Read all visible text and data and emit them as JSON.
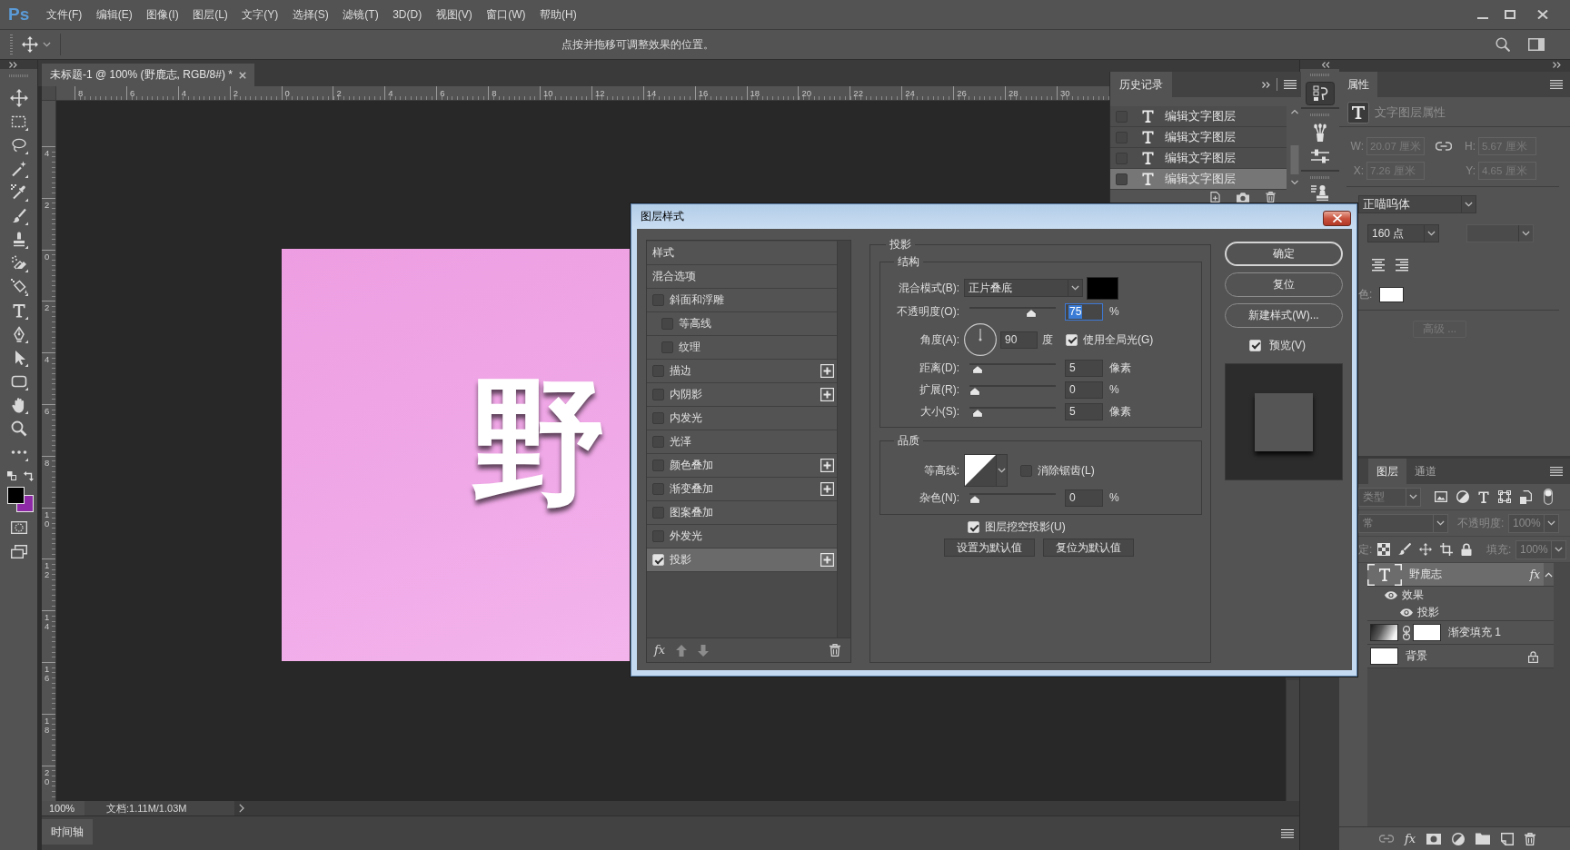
{
  "app": {
    "logo": "Ps"
  },
  "menu_bar": [
    "文件(F)",
    "编辑(E)",
    "图像(I)",
    "图层(L)",
    "文字(Y)",
    "选择(S)",
    "滤镜(T)",
    "3D(D)",
    "视图(V)",
    "窗口(W)",
    "帮助(H)"
  ],
  "options_bar": {
    "hint": "点按并拖移可调整效果的位置。"
  },
  "document": {
    "tab_title": "未标题-1 @ 100% (野鹿志, RGB/8#) *",
    "horizontal_ruler": [
      "8",
      "6",
      "4",
      "2",
      "0",
      "2",
      "4",
      "6",
      "8",
      "10",
      "12",
      "14",
      "16",
      "18",
      "20",
      "22",
      "24",
      "26",
      "28",
      "30"
    ],
    "vertical_ruler": [
      "4",
      "2",
      "0",
      "2",
      "4",
      "6",
      "8",
      "10",
      "12",
      "14",
      "16",
      "18",
      "20"
    ],
    "canvas_text": "野",
    "zoom": "100%",
    "doc_info": "文档:1.11M/1.03M"
  },
  "timeline": {
    "tab": "时间轴"
  },
  "history_panel": {
    "tab": "历史记录",
    "items": [
      {
        "label": "编辑文字图层",
        "checked": false,
        "selected": false
      },
      {
        "label": "编辑文字图层",
        "checked": false,
        "selected": false
      },
      {
        "label": "编辑文字图层",
        "checked": false,
        "selected": false
      },
      {
        "label": "编辑文字图层",
        "checked": false,
        "selected": true
      }
    ]
  },
  "properties_panel": {
    "tab": "属性",
    "heading": "文字图层属性",
    "metrics": [
      {
        "label": "W:",
        "value": "20.07 厘米",
        "disabled": true
      },
      {
        "label": "H:",
        "value": "5.67 厘米",
        "disabled": true
      },
      {
        "label": "X:",
        "value": "7.26 厘米",
        "disabled": true
      },
      {
        "label": "Y:",
        "value": "4.65 厘米",
        "disabled": true
      }
    ],
    "font_family": "正喵呜体",
    "font_size": "160 点",
    "color_label": "色:",
    "advanced_button": {
      "label": "高级 ...",
      "disabled": true
    }
  },
  "layers_panel": {
    "tabs": [
      {
        "label": "图层",
        "selected": true
      },
      {
        "label": "通道",
        "selected": false
      }
    ],
    "filter_kind": "类型",
    "blend_mode": "常",
    "opacity_label": "不透明度:",
    "opacity": "100%",
    "lock_label": "定:",
    "fill_label": "填充:",
    "fill": "100%",
    "layers": [
      {
        "kind": "text",
        "name": "野鹿志",
        "selected": true,
        "expanded": true,
        "badge": "fx",
        "locked": false,
        "children": [
          {
            "kind": "effects",
            "name": "效果",
            "visible": true,
            "children": [
              {
                "kind": "effect",
                "name": "投影",
                "visible": true
              }
            ]
          }
        ]
      },
      {
        "kind": "gradient_fill",
        "name": "渐变填充 1",
        "selected": false,
        "locked": false
      },
      {
        "kind": "background",
        "name": "背景",
        "selected": false,
        "locked": true
      }
    ],
    "footer_fx": "fx"
  },
  "dialog": {
    "title": "图层样式",
    "styles": [
      {
        "kind": "header",
        "label": "样式",
        "selected": false
      },
      {
        "kind": "plain",
        "label": "混合选项",
        "selected": false
      },
      {
        "kind": "check",
        "label": "斜面和浮雕",
        "checked": false,
        "selected": false,
        "add_button": false
      },
      {
        "kind": "subcheck",
        "label": "等高线",
        "checked": false,
        "selected": false,
        "add_button": false
      },
      {
        "kind": "subcheck",
        "label": "纹理",
        "checked": false,
        "selected": false,
        "add_button": false
      },
      {
        "kind": "check",
        "label": "描边",
        "checked": false,
        "selected": false,
        "add_button": true
      },
      {
        "kind": "check",
        "label": "内阴影",
        "checked": false,
        "selected": false,
        "add_button": true
      },
      {
        "kind": "check",
        "label": "内发光",
        "checked": false,
        "selected": false,
        "add_button": false
      },
      {
        "kind": "check",
        "label": "光泽",
        "checked": false,
        "selected": false,
        "add_button": false
      },
      {
        "kind": "check",
        "label": "颜色叠加",
        "checked": false,
        "selected": false,
        "add_button": true
      },
      {
        "kind": "check",
        "label": "渐变叠加",
        "checked": false,
        "selected": false,
        "add_button": true
      },
      {
        "kind": "check",
        "label": "图案叠加",
        "checked": false,
        "selected": false,
        "add_button": false
      },
      {
        "kind": "check",
        "label": "外发光",
        "checked": false,
        "selected": false,
        "add_button": false
      },
      {
        "kind": "check",
        "label": "投影",
        "checked": true,
        "selected": true,
        "add_button": true
      }
    ],
    "list_footer_fx": "fx",
    "section": {
      "title": "投影",
      "groups": [
        {
          "title": "结构",
          "rows": [
            {
              "kind": "select",
              "label": "混合模式(B):",
              "value": "正片叠底"
            },
            {
              "kind": "slider",
              "label": "不透明度(O):",
              "level": 0.75,
              "value": "75",
              "unit": "%",
              "focused": true
            },
            {
              "kind": "angle",
              "label": "角度(A):",
              "value": "90",
              "unit": "度",
              "checkbox": {
                "label": "使用全局光(G)",
                "checked": true
              }
            },
            {
              "kind": "slider",
              "label": "距离(D):",
              "level": 0.04,
              "value": "5",
              "unit": "像素",
              "focused": false
            },
            {
              "kind": "slider",
              "label": "扩展(R):",
              "level": 0,
              "value": "0",
              "unit": "%",
              "focused": false
            },
            {
              "kind": "slider",
              "label": "大小(S):",
              "level": 0.04,
              "value": "5",
              "unit": "像素",
              "focused": false
            }
          ]
        },
        {
          "title": "品质",
          "rows": [
            {
              "kind": "contour",
              "label": "等高线:",
              "checkbox": {
                "label": "消除锯齿(L)",
                "checked": false
              }
            },
            {
              "kind": "slider",
              "label": "杂色(N):",
              "level": 0,
              "value": "0",
              "unit": "%",
              "focused": false
            }
          ]
        }
      ],
      "knockout": {
        "label": "图层挖空投影(U)",
        "checked": true
      },
      "default_buttons": [
        "设置为默认值",
        "复位为默认值"
      ]
    },
    "buttons": [
      {
        "label": "确定",
        "default": true
      },
      {
        "label": "复位",
        "default": false
      },
      {
        "label": "新建样式(W)...",
        "default": false
      }
    ],
    "preview": {
      "label": "预览(V)",
      "checked": true
    }
  }
}
